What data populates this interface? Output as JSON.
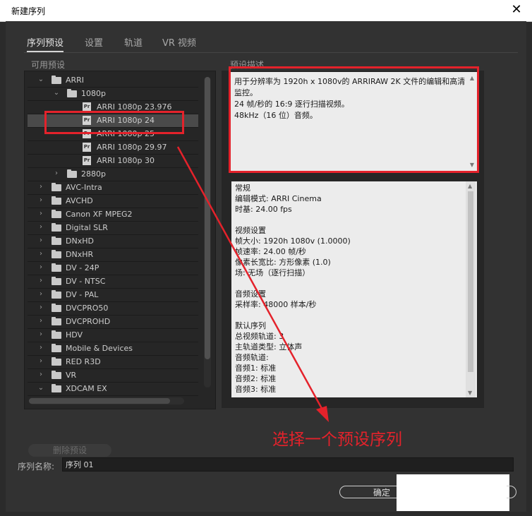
{
  "window": {
    "title": "新建序列",
    "close_glyph": "✕"
  },
  "tabs": [
    {
      "label": "序列预设",
      "active": true
    },
    {
      "label": "设置",
      "active": false
    },
    {
      "label": "轨道",
      "active": false
    },
    {
      "label": "VR 视频",
      "active": false
    }
  ],
  "presets": {
    "label": "可用预设",
    "items": [
      {
        "label": "ARRI",
        "type": "folder",
        "expanded": true,
        "level": 0
      },
      {
        "label": "1080p",
        "type": "folder",
        "expanded": true,
        "level": 1
      },
      {
        "label": "ARRI 1080p 23.976",
        "type": "preset",
        "level": 2
      },
      {
        "label": "ARRI 1080p 24",
        "type": "preset",
        "level": 2,
        "selected": true
      },
      {
        "label": "ARRI 1080p 25",
        "type": "preset",
        "level": 2
      },
      {
        "label": "ARRI 1080p 29.97",
        "type": "preset",
        "level": 2
      },
      {
        "label": "ARRI 1080p 30",
        "type": "preset",
        "level": 2
      },
      {
        "label": "2880p",
        "type": "folder",
        "expanded": false,
        "level": 1
      },
      {
        "label": "AVC-Intra",
        "type": "folder",
        "expanded": false,
        "level": 0
      },
      {
        "label": "AVCHD",
        "type": "folder",
        "expanded": false,
        "level": 0
      },
      {
        "label": "Canon XF MPEG2",
        "type": "folder",
        "expanded": false,
        "level": 0
      },
      {
        "label": "Digital SLR",
        "type": "folder",
        "expanded": false,
        "level": 0
      },
      {
        "label": "DNxHD",
        "type": "folder",
        "expanded": false,
        "level": 0
      },
      {
        "label": "DNxHR",
        "type": "folder",
        "expanded": false,
        "level": 0
      },
      {
        "label": "DV - 24P",
        "type": "folder",
        "expanded": false,
        "level": 0
      },
      {
        "label": "DV - NTSC",
        "type": "folder",
        "expanded": false,
        "level": 0
      },
      {
        "label": "DV - PAL",
        "type": "folder",
        "expanded": false,
        "level": 0
      },
      {
        "label": "DVCPRO50",
        "type": "folder",
        "expanded": false,
        "level": 0
      },
      {
        "label": "DVCPROHD",
        "type": "folder",
        "expanded": false,
        "level": 0
      },
      {
        "label": "HDV",
        "type": "folder",
        "expanded": false,
        "level": 0
      },
      {
        "label": "Mobile & Devices",
        "type": "folder",
        "expanded": false,
        "level": 0
      },
      {
        "label": "RED R3D",
        "type": "folder",
        "expanded": false,
        "level": 0
      },
      {
        "label": "VR",
        "type": "folder",
        "expanded": false,
        "level": 0
      },
      {
        "label": "XDCAM EX",
        "type": "folder",
        "expanded": true,
        "level": 0
      }
    ],
    "preset_icon_text": "Pr",
    "delete_button": "删除预设"
  },
  "description": {
    "label": "预设描述",
    "lines": [
      "用于分辨率为 1920h x 1080v的 ARRIRAW 2K 文件的编辑和高清",
      "监控。",
      "24 帧/秒的 16:9 逐行扫描视频。",
      "48kHz（16 位）音频。"
    ]
  },
  "details": {
    "lines": [
      "常规",
      " 编辑模式: ARRI Cinema",
      " 时基: 24.00 fps",
      "",
      "视频设置",
      " 帧大小: 1920h 1080v (1.0000)",
      " 帧速率: 24.00  帧/秒",
      " 像素长宽比: 方形像素 (1.0)",
      " 场: 无场（逐行扫描）",
      "",
      "音频设置",
      " 采样率: 48000 样本/秒",
      "",
      "默认序列",
      " 总视频轨道: 3",
      " 主轨道类型: 立体声",
      " 音频轨道:",
      " 音频1: 标准",
      " 音频2: 标准",
      " 音频3: 标准"
    ]
  },
  "annotation": {
    "text": "选择一个预设序列",
    "color": "#e4222b"
  },
  "sequence_name": {
    "label": "序列名称:",
    "value": "序列 01"
  },
  "ok_button": "确定",
  "icons": {
    "close": "close-icon",
    "chevron_down": "chevron-down-icon",
    "chevron_right": "chevron-right-icon",
    "folder": "folder-icon",
    "preset": "premiere-preset-icon"
  }
}
